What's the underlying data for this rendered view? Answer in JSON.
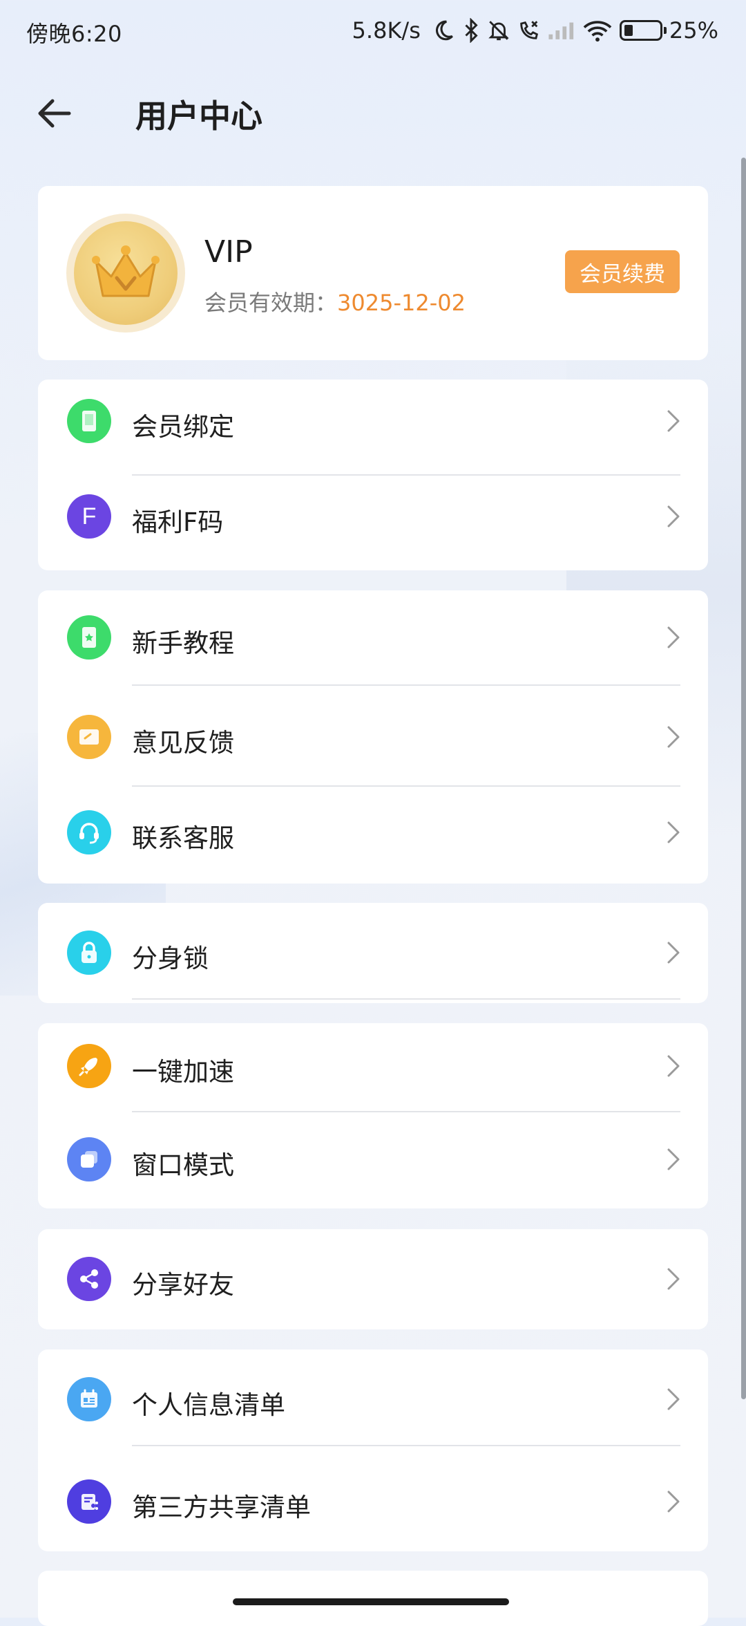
{
  "status_bar": {
    "time": "傍晚6:20",
    "net_speed": "5.8K/s",
    "battery_level": 0.25,
    "battery_text": "25%",
    "icons": [
      "moon-icon",
      "bluetooth-icon",
      "bell-off-icon",
      "call-blocked-icon",
      "signal-icon",
      "wifi-icon",
      "battery-icon"
    ]
  },
  "header": {
    "title": "用户中心",
    "back_icon": "back-arrow-icon"
  },
  "vip_card": {
    "name": "VIP",
    "expiry_label": "会员有效期：",
    "expiry_date": "3025-12-02",
    "renew_label": "会员续费",
    "avatar_icon": "crown-icon"
  },
  "groups": [
    {
      "items": [
        {
          "label": "会员绑定",
          "icon": "phone-icon",
          "color": "#3ddb6b"
        },
        {
          "label": "福利F码",
          "icon": "f-code-icon",
          "color": "#6b45e2"
        }
      ]
    },
    {
      "items": [
        {
          "label": "新手教程",
          "icon": "guide-book-icon",
          "color": "#3ddb6b"
        },
        {
          "label": "意见反馈",
          "icon": "feedback-icon",
          "color": "#f6b63c"
        },
        {
          "label": "联系客服",
          "icon": "headset-icon",
          "color": "#29d0ea"
        }
      ]
    },
    {
      "items": [
        {
          "label": "分身锁",
          "icon": "lock-icon",
          "color": "#29d0ea"
        }
      ]
    },
    {
      "items": [
        {
          "label": "一键加速",
          "icon": "rocket-icon",
          "color": "#f7a413"
        },
        {
          "label": "窗口模式",
          "icon": "window-icon",
          "color": "#5d84f3"
        }
      ]
    },
    {
      "items": [
        {
          "label": "分享好友",
          "icon": "share-icon",
          "color": "#6b45e2"
        }
      ]
    },
    {
      "items": [
        {
          "label": "个人信息清单",
          "icon": "info-list-icon",
          "color": "#4aa7f2"
        },
        {
          "label": "第三方共享清单",
          "icon": "share-list-icon",
          "color": "#4f3ee0"
        }
      ]
    }
  ],
  "f_code_glyph": "F"
}
